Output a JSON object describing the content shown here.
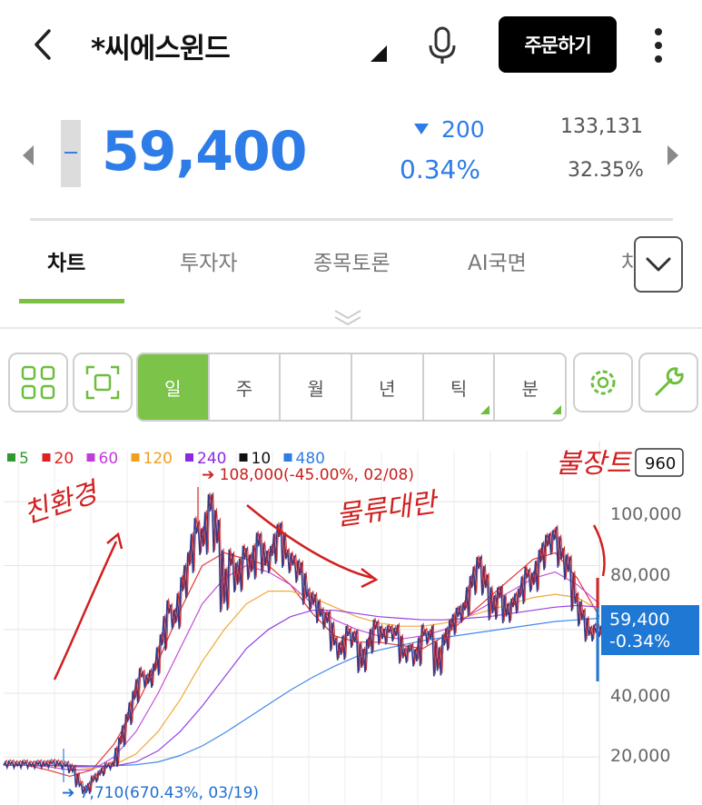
{
  "header": {
    "back_icon": "chevron-left-icon",
    "title": "*씨에스윈드",
    "mic_icon": "microphone-icon",
    "order_button": "주문하기",
    "more_icon": "more-vertical-icon"
  },
  "quote": {
    "price": "59,400",
    "change": "200",
    "change_pct": "0.34%",
    "volume": "133,131",
    "volume_pct": "32.35%",
    "color_down": "#2e7ce8"
  },
  "tabs": [
    "차트",
    "투자자",
    "종목토론",
    "AI국면",
    "차"
  ],
  "toolbar": {
    "periods": [
      "일",
      "주",
      "월",
      "년",
      "틱",
      "분"
    ],
    "active_period": "일",
    "accent": "#7cc34a"
  },
  "chart_data": {
    "type": "line",
    "legend": [
      {
        "label": "5",
        "color": "#2e9a2e"
      },
      {
        "label": "20",
        "color": "#e02020"
      },
      {
        "label": "60",
        "color": "#c03cd8"
      },
      {
        "label": "120",
        "color": "#f0a020"
      },
      {
        "label": "240",
        "color": "#8a2be2"
      },
      {
        "label": "10",
        "color": "#111111"
      },
      {
        "label": "480",
        "color": "#2e7ce8"
      }
    ],
    "y_ticks": [
      "100,000",
      "80,000",
      "40,000",
      "20,000"
    ],
    "ylim": [
      5000,
      116000
    ],
    "max_annotation": "108,000(-45.00%, 02/08)",
    "min_annotation": "7,710(670.43%, 03/19)",
    "top_right_label": "960",
    "current_value": "59,400",
    "current_change": "-0.34%",
    "price_series": [
      17500,
      17800,
      17300,
      17900,
      17200,
      17800,
      17400,
      18000,
      17600,
      17200,
      15500,
      11000,
      8800,
      12500,
      14500,
      16800,
      17500,
      24000,
      31000,
      38000,
      45000,
      43000,
      47000,
      55000,
      65000,
      62000,
      72000,
      80000,
      90000,
      86000,
      97000,
      87000,
      68000,
      80000,
      74000,
      82000,
      78000,
      86000,
      80000,
      83000,
      89000,
      82000,
      80000,
      77000,
      70000,
      68000,
      64000,
      62000,
      55000,
      52000,
      58000,
      56000,
      48000,
      54000,
      60000,
      57000,
      59000,
      58000,
      51000,
      53000,
      50000,
      58000,
      57000,
      47000,
      55000,
      60000,
      64000,
      66000,
      73000,
      79000,
      73000,
      65000,
      70000,
      64000,
      67000,
      70000,
      76000,
      74000,
      81000,
      86000,
      88000,
      82000,
      78000,
      68000,
      63000,
      58000,
      59400
    ],
    "ma_series": [
      {
        "name": "20",
        "color": "#e02020",
        "values": [
          17500,
          17500,
          16000,
          14000,
          16000,
          24000,
          36000,
          50000,
          66000,
          80000,
          84000,
          82000,
          80000,
          74000,
          65000,
          58000,
          56000,
          56000,
          55000,
          54000,
          58000,
          64000,
          70000,
          76000,
          82000,
          84000,
          76000,
          64000
        ]
      },
      {
        "name": "60",
        "color": "#c03cd8",
        "values": [
          17500,
          17500,
          17000,
          16000,
          16000,
          20000,
          28000,
          40000,
          54000,
          68000,
          76000,
          80000,
          78000,
          74000,
          68000,
          63000,
          60000,
          58000,
          57000,
          58000,
          60000,
          64000,
          68000,
          72000,
          76000,
          78000,
          74000,
          68000
        ]
      },
      {
        "name": "120",
        "color": "#f0a020",
        "values": [
          17500,
          17500,
          17300,
          17000,
          16500,
          17500,
          21000,
          28000,
          38000,
          50000,
          60000,
          68000,
          72000,
          72000,
          70000,
          67000,
          64000,
          62000,
          61000,
          61000,
          62000,
          64000,
          66000,
          68000,
          70000,
          71000,
          70000,
          66000
        ]
      },
      {
        "name": "240",
        "color": "#8a2be2",
        "values": [
          17500,
          17500,
          17400,
          17200,
          17000,
          17200,
          18500,
          22000,
          28000,
          36000,
          45000,
          54000,
          60000,
          64000,
          66000,
          66000,
          65000,
          64000,
          63500,
          63000,
          63000,
          63500,
          64000,
          65000,
          66000,
          67000,
          67500,
          67000
        ]
      },
      {
        "name": "480",
        "color": "#2e7ce8",
        "values": [
          17500,
          17500,
          17500,
          17400,
          17300,
          17300,
          17600,
          18500,
          20500,
          23500,
          27500,
          32000,
          36500,
          41000,
          45000,
          48500,
          51500,
          53500,
          55000,
          56500,
          57500,
          58500,
          59500,
          60500,
          61500,
          62500,
          63000,
          63500
        ]
      }
    ],
    "handwritten": [
      "친환경",
      "물류대란",
      "불장트"
    ]
  }
}
